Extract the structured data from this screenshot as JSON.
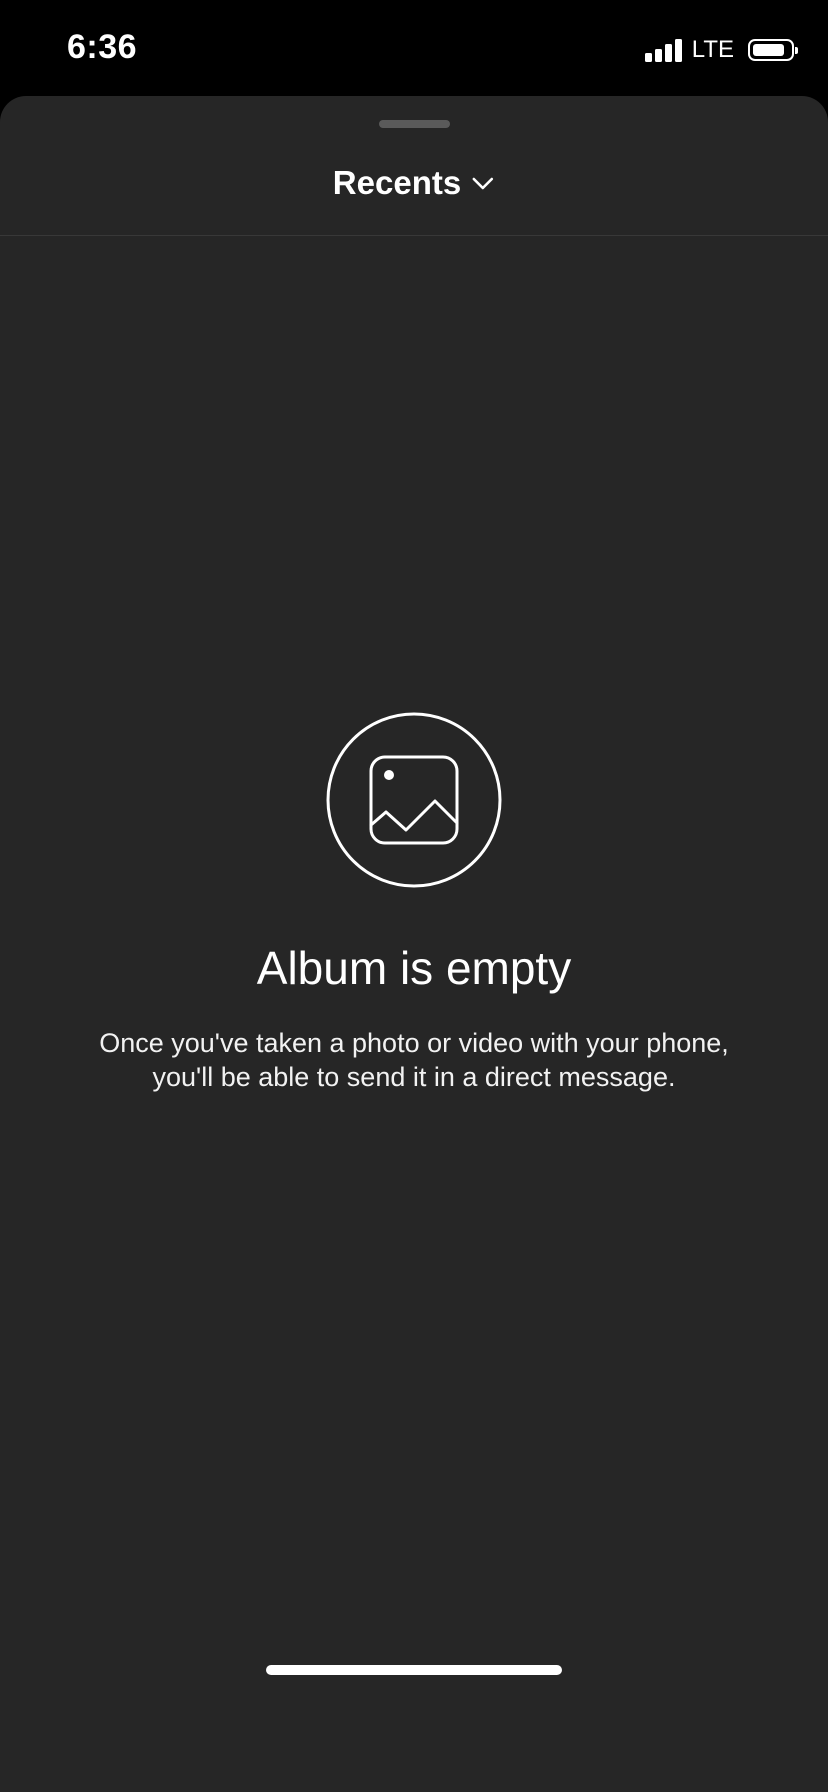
{
  "status_bar": {
    "time": "6:36",
    "network": "LTE",
    "signal_bars": 4,
    "battery_level": 0.85,
    "icons": [
      "signal-icon",
      "battery-icon"
    ]
  },
  "header": {
    "album_title": "Recents",
    "album_icon": "chevron-down-icon"
  },
  "empty_state": {
    "icon": "photo-circle-icon",
    "title": "Album is empty",
    "message_line_1": "Once you've taken a photo or video with your phone,",
    "message_line_2": "you'll be able to send it in a direct message."
  },
  "colors": {
    "background": "#000000",
    "sheet": "#262626",
    "text": "#ffffff",
    "grabber": "#5a5a5a",
    "divider": "#383838"
  }
}
